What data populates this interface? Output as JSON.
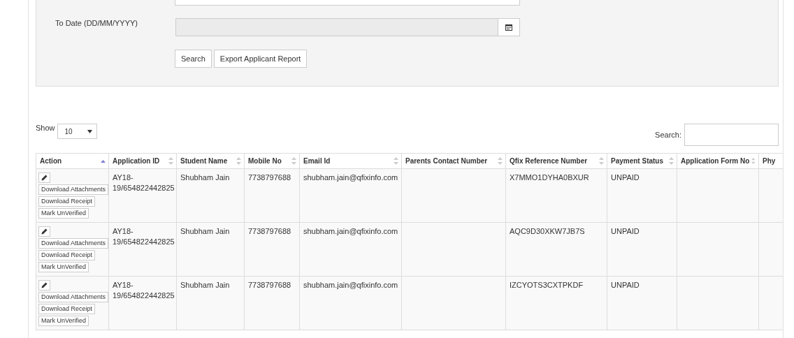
{
  "filter": {
    "to_date_label": "To Date (DD/MM/YYYY)",
    "to_date_disabled": true,
    "buttons": [
      "Search",
      "Export Applicant Report"
    ]
  },
  "table_controls": {
    "show_label": "Show",
    "page_size": "10",
    "search_label": "Search:"
  },
  "table": {
    "columns": [
      {
        "label": "Action",
        "sorted": true
      },
      {
        "label": "Application ID",
        "sorted": false
      },
      {
        "label": "Student Name",
        "sorted": false
      },
      {
        "label": "Mobile No",
        "sorted": false
      },
      {
        "label": "Email Id",
        "sorted": false
      },
      {
        "label": "Parents Contact Number",
        "sorted": false
      },
      {
        "label": "Qfix Reference Number",
        "sorted": false
      },
      {
        "label": "Payment Status",
        "sorted": false
      },
      {
        "label": "Application Form No",
        "sorted": false
      },
      {
        "label": "Phy"
      }
    ],
    "rows": [
      {
        "cells": [
          {
            "actions": [
              "Download Attachments",
              "Download Receipt",
              "Mark UnVerified"
            ]
          },
          "AY18-19/654822442825",
          "Shubham Jain",
          "7738797688",
          "shubham.jain@qfixinfo.com",
          "",
          "X7MMO1DYHA0BXUR",
          "UNPAID",
          "",
          ""
        ]
      },
      {
        "cells": [
          {
            "actions": [
              "Download Attachments",
              "Download Receipt",
              "Mark UnVerified"
            ]
          },
          "AY18-19/654822442825",
          "Shubham Jain",
          "7738797688",
          "shubham.jain@qfixinfo.com",
          "",
          "AQC9D30XKW7JB7S",
          "UNPAID",
          "",
          ""
        ]
      },
      {
        "cells": [
          {
            "actions": [
              "Download Attachments",
              "Download Receipt",
              "Mark UnVerified"
            ]
          },
          "AY18-19/654822442825",
          "Shubham Jain",
          "7738797688",
          "shubham.jain@qfixinfo.com",
          "",
          "IZCYOTS3CXTPKDF",
          "UNPAID",
          "",
          ""
        ]
      }
    ]
  }
}
